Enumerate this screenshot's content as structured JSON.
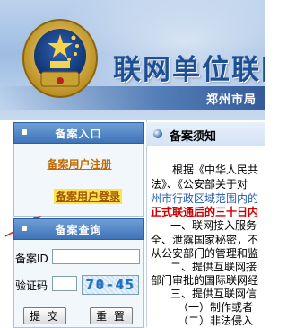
{
  "banner": {
    "title": "联网单位联网",
    "subtitle": "郑州市局"
  },
  "sidebar": {
    "filing_section": {
      "heading": "备案入口",
      "links": [
        "备案用户注册",
        "备案用户登录"
      ],
      "active_link": "备案用户登录"
    },
    "query_section": {
      "heading": "备案查询",
      "id_label": "备案ID",
      "id_value": "",
      "captcha_label": "验证码",
      "captcha_value": "",
      "captcha_image_text": "70-45",
      "submit_label": "提 交",
      "reset_label": "重 置"
    }
  },
  "main": {
    "section_title": "备案须知",
    "lines": [
      {
        "text": "根据《中华人民共",
        "style": "plain"
      },
      {
        "text": "法》、《公安部关于对",
        "style": "plain"
      },
      {
        "text": "州市行政区域范围内的",
        "style": "blue"
      },
      {
        "text": "正式联通后的三十日内",
        "style": "red"
      },
      {
        "text": "一、联网接入服务",
        "style": "plain"
      },
      {
        "text": "全、泄露国家秘密，不",
        "style": "plain"
      },
      {
        "text": "从公安部门的管理和监",
        "style": "plain"
      },
      {
        "text": "二、提供互联网接",
        "style": "plain"
      },
      {
        "text": "部门审批的国际联网经",
        "style": "plain"
      },
      {
        "text": "三、提供互联网信",
        "style": "plain"
      },
      {
        "text": "（一）制作或者",
        "style": "plain"
      },
      {
        "text": "（二）非法侵入",
        "style": "plain"
      }
    ]
  },
  "colors": {
    "link_orange": "#c26a00",
    "header_blue": "#3f74b8",
    "highlight_yellow": "#ffe24d",
    "notice_red": "#cc0000",
    "text_blue": "#2a5db0"
  }
}
